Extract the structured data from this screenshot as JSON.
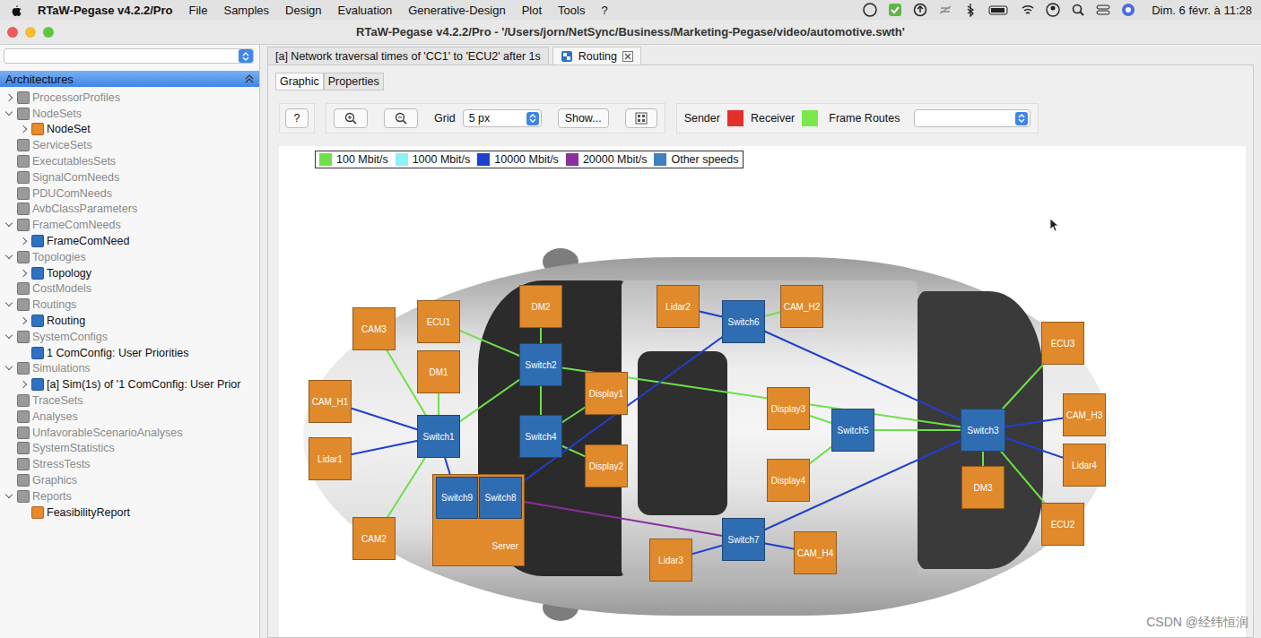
{
  "menubar": {
    "app": "RTaW-Pegase v4.2.2/Pro",
    "menus": [
      "File",
      "Samples",
      "Design",
      "Evaluation",
      "Generative-Design",
      "Plot",
      "Tools",
      "?"
    ],
    "clock": "Dim. 6 févr. à 11:28"
  },
  "window": {
    "title": "RTaW-Pegase v4.2.2/Pro - '/Users/jorn/NetSync/Business/Marketing-Pegase/video/automotive.swth'"
  },
  "sidebar": {
    "header": "Architectures",
    "items": [
      {
        "label": "ProcessorProfiles",
        "level": 0,
        "kind": "branch",
        "expanded": false,
        "dimmed": true,
        "color": "#9a9a9a"
      },
      {
        "label": "NodeSets",
        "level": 0,
        "kind": "branch",
        "expanded": true,
        "dimmed": true,
        "color": "#9a9a9a"
      },
      {
        "label": "NodeSet",
        "level": 1,
        "kind": "branch",
        "expanded": false,
        "dimmed": false,
        "color": "#e8892b"
      },
      {
        "label": "ServiceSets",
        "level": 0,
        "kind": "leaf",
        "expanded": false,
        "dimmed": true,
        "color": "#9a9a9a"
      },
      {
        "label": "ExecutablesSets",
        "level": 0,
        "kind": "leaf",
        "expanded": false,
        "dimmed": true,
        "color": "#9a9a9a"
      },
      {
        "label": "SignalComNeeds",
        "level": 0,
        "kind": "leaf",
        "expanded": false,
        "dimmed": true,
        "color": "#9a9a9a"
      },
      {
        "label": "PDUComNeeds",
        "level": 0,
        "kind": "leaf",
        "expanded": false,
        "dimmed": true,
        "color": "#9a9a9a"
      },
      {
        "label": "AvbClassParameters",
        "level": 0,
        "kind": "leaf",
        "expanded": false,
        "dimmed": true,
        "color": "#9a9a9a"
      },
      {
        "label": "FrameComNeeds",
        "level": 0,
        "kind": "branch",
        "expanded": true,
        "dimmed": true,
        "color": "#9a9a9a"
      },
      {
        "label": "FrameComNeed",
        "level": 1,
        "kind": "branch",
        "expanded": false,
        "dimmed": false,
        "color": "#2f72c4"
      },
      {
        "label": "Topologies",
        "level": 0,
        "kind": "branch",
        "expanded": true,
        "dimmed": true,
        "color": "#9a9a9a"
      },
      {
        "label": "Topology",
        "level": 1,
        "kind": "branch",
        "expanded": false,
        "dimmed": false,
        "color": "#2f72c4"
      },
      {
        "label": "CostModels",
        "level": 0,
        "kind": "leaf",
        "expanded": false,
        "dimmed": true,
        "color": "#9a9a9a"
      },
      {
        "label": "Routings",
        "level": 0,
        "kind": "branch",
        "expanded": true,
        "dimmed": true,
        "color": "#9a9a9a"
      },
      {
        "label": "Routing",
        "level": 1,
        "kind": "branch",
        "expanded": false,
        "dimmed": false,
        "color": "#2f72c4"
      },
      {
        "label": "SystemConfigs",
        "level": 0,
        "kind": "branch",
        "expanded": true,
        "dimmed": true,
        "color": "#9a9a9a"
      },
      {
        "label": "1 ComConfig: User Priorities",
        "level": 1,
        "kind": "leaf",
        "expanded": false,
        "dimmed": false,
        "color": "#2f72c4"
      },
      {
        "label": "Simulations",
        "level": 0,
        "kind": "branch",
        "expanded": true,
        "dimmed": true,
        "color": "#9a9a9a"
      },
      {
        "label": "[a] Sim(1s) of '1 ComConfig: User Prior",
        "level": 1,
        "kind": "branch",
        "expanded": false,
        "dimmed": false,
        "color": "#2f72c4"
      },
      {
        "label": "TraceSets",
        "level": 0,
        "kind": "leaf",
        "expanded": false,
        "dimmed": true,
        "color": "#9a9a9a"
      },
      {
        "label": "Analyses",
        "level": 0,
        "kind": "leaf",
        "expanded": false,
        "dimmed": true,
        "color": "#9a9a9a"
      },
      {
        "label": "UnfavorableScenarioAnalyses",
        "level": 0,
        "kind": "leaf",
        "expanded": false,
        "dimmed": true,
        "color": "#9a9a9a"
      },
      {
        "label": "SystemStatistics",
        "level": 0,
        "kind": "leaf",
        "expanded": false,
        "dimmed": true,
        "color": "#9a9a9a"
      },
      {
        "label": "StressTests",
        "level": 0,
        "kind": "leaf",
        "expanded": false,
        "dimmed": true,
        "color": "#9a9a9a"
      },
      {
        "label": "Graphics",
        "level": 0,
        "kind": "leaf",
        "expanded": false,
        "dimmed": true,
        "color": "#9a9a9a"
      },
      {
        "label": "Reports",
        "level": 0,
        "kind": "branch",
        "expanded": true,
        "dimmed": true,
        "color": "#9a9a9a"
      },
      {
        "label": "FeasibilityReport",
        "level": 1,
        "kind": "leaf",
        "expanded": false,
        "dimmed": false,
        "color": "#e8892b"
      }
    ]
  },
  "tabs": [
    {
      "label": "[a] Network traversal times of 'CC1' to 'ECU2' after 1s",
      "selected": false,
      "closable": false
    },
    {
      "label": "Routing",
      "selected": true,
      "closable": true
    }
  ],
  "subtabs": [
    {
      "label": "Graphic",
      "selected": true
    },
    {
      "label": "Properties",
      "selected": false
    }
  ],
  "toolbar": {
    "help": "?",
    "grid_label": "Grid",
    "grid_value": "5 px",
    "show_button": "Show...",
    "route_keys": [
      {
        "label": "Sender",
        "color": "#e3302a"
      },
      {
        "label": "Receiver",
        "color": "#7ae84a"
      }
    ],
    "routes_label": "Frame Routes"
  },
  "legend": [
    {
      "label": "100 Mbit/s",
      "color": "#6ee04a"
    },
    {
      "label": "1000 Mbit/s",
      "color": "#8ef0f8"
    },
    {
      "label": "10000 Mbit/s",
      "color": "#1f3fd0"
    },
    {
      "label": "20000 Mbit/s",
      "color": "#8a2f9e"
    },
    {
      "label": "Other speeds",
      "color": "#3f7fc2"
    }
  ],
  "nodes": [
    {
      "name": "CAM3",
      "kind": "ecu"
    },
    {
      "name": "ECU1",
      "kind": "ecu"
    },
    {
      "name": "DM2",
      "kind": "ecu"
    },
    {
      "name": "Lidar2",
      "kind": "ecu"
    },
    {
      "name": "CAM_H2",
      "kind": "ecu"
    },
    {
      "name": "ECU3",
      "kind": "ecu"
    },
    {
      "name": "DM1",
      "kind": "ecu"
    },
    {
      "name": "Display1",
      "kind": "ecu"
    },
    {
      "name": "CAM_H1",
      "kind": "ecu"
    },
    {
      "name": "Display3",
      "kind": "ecu"
    },
    {
      "name": "CAM_H3",
      "kind": "ecu"
    },
    {
      "name": "Lidar1",
      "kind": "ecu"
    },
    {
      "name": "Display2",
      "kind": "ecu"
    },
    {
      "name": "Display4",
      "kind": "ecu"
    },
    {
      "name": "Lidar4",
      "kind": "ecu"
    },
    {
      "name": "DM3",
      "kind": "ecu"
    },
    {
      "name": "ECU2",
      "kind": "ecu"
    },
    {
      "name": "CAM2",
      "kind": "ecu"
    },
    {
      "name": "Lidar3",
      "kind": "ecu"
    },
    {
      "name": "CAM_H4",
      "kind": "ecu"
    },
    {
      "name": "Switch6",
      "kind": "switch"
    },
    {
      "name": "Switch2",
      "kind": "switch"
    },
    {
      "name": "Switch1",
      "kind": "switch"
    },
    {
      "name": "Switch4",
      "kind": "switch"
    },
    {
      "name": "Switch5",
      "kind": "switch"
    },
    {
      "name": "Switch3",
      "kind": "switch"
    },
    {
      "name": "Switch7",
      "kind": "switch"
    },
    {
      "name": "Server",
      "kind": "server"
    },
    {
      "name": "Switch9",
      "kind": "switch"
    },
    {
      "name": "Switch8",
      "kind": "switch"
    }
  ],
  "links": [
    {
      "from": "CAM3",
      "to": "Switch1",
      "color": "#6ee04a"
    },
    {
      "from": "DM1",
      "to": "Switch1",
      "color": "#6ee04a"
    },
    {
      "from": "CAM_H1",
      "to": "Switch1",
      "color": "#1f3fd0"
    },
    {
      "from": "Lidar1",
      "to": "Switch1",
      "color": "#1f3fd0"
    },
    {
      "from": "CAM2",
      "to": "Switch1",
      "color": "#6ee04a"
    },
    {
      "from": "Switch1",
      "to": "Switch2",
      "color": "#6ee04a"
    },
    {
      "from": "Switch1",
      "to": "Switch9",
      "color": "#1f3fd0"
    },
    {
      "from": "ECU1",
      "to": "Switch2",
      "color": "#6ee04a"
    },
    {
      "from": "DM2",
      "to": "Switch2",
      "color": "#6ee04a"
    },
    {
      "from": "Switch2",
      "to": "Switch4",
      "color": "#6ee04a"
    },
    {
      "from": "Switch2",
      "to": "Switch3",
      "color": "#6ee04a"
    },
    {
      "from": "Switch4",
      "to": "Display1",
      "color": "#6ee04a"
    },
    {
      "from": "Switch4",
      "to": "Display2",
      "color": "#6ee04a"
    },
    {
      "from": "Lidar2",
      "to": "Switch6",
      "color": "#1f3fd0"
    },
    {
      "from": "CAM_H2",
      "to": "Switch6",
      "color": "#6ee04a"
    },
    {
      "from": "Switch6",
      "to": "Switch3",
      "color": "#1f3fd0"
    },
    {
      "from": "Switch6",
      "to": "Switch8",
      "color": "#1f3fd0"
    },
    {
      "from": "Switch8",
      "to": "Switch7",
      "color": "#8a2f9e"
    },
    {
      "from": "Switch7",
      "to": "Switch3",
      "color": "#1f3fd0"
    },
    {
      "from": "Lidar3",
      "to": "Switch7",
      "color": "#1f3fd0"
    },
    {
      "from": "CAM_H4",
      "to": "Switch7",
      "color": "#1f3fd0"
    },
    {
      "from": "Display3",
      "to": "Switch5",
      "color": "#6ee04a"
    },
    {
      "from": "Display4",
      "to": "Switch5",
      "color": "#6ee04a"
    },
    {
      "from": "Switch5",
      "to": "Switch3",
      "color": "#6ee04a"
    },
    {
      "from": "ECU3",
      "to": "Switch3",
      "color": "#6ee04a"
    },
    {
      "from": "CAM_H3",
      "to": "Switch3",
      "color": "#1f3fd0"
    },
    {
      "from": "Lidar4",
      "to": "Switch3",
      "color": "#1f3fd0"
    },
    {
      "from": "DM3",
      "to": "Switch3",
      "color": "#6ee04a"
    },
    {
      "from": "ECU2",
      "to": "Switch3",
      "color": "#6ee04a"
    }
  ],
  "watermark": "CSDN @经纬恒润"
}
